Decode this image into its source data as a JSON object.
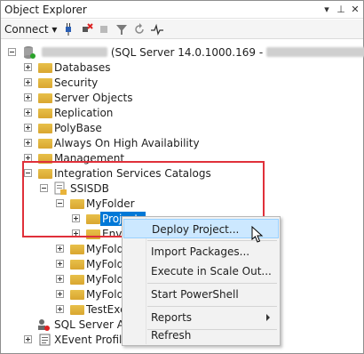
{
  "window": {
    "title": "Object Explorer"
  },
  "toolbar": {
    "connect_label": "Connect ▾"
  },
  "tree": {
    "server_label": "(SQL Server 14.0.1000.169 -",
    "server_close": ")",
    "items": {
      "databases": "Databases",
      "security": "Security",
      "server_objects": "Server Objects",
      "replication": "Replication",
      "polybase": "PolyBase",
      "always_on": "Always On High Availability",
      "management": "Management",
      "isc": "Integration Services Catalogs",
      "ssisdb": "SSISDB",
      "myfolder": "MyFolder",
      "projects": "Projects",
      "envi": "Envi",
      "myfolde_1": "MyFolde",
      "myfolde_2": "MyFolde",
      "myfolde_3": "MyFolde",
      "myfolde_4": "MyFolde",
      "testexce": "TestExce",
      "sql_agent": "SQL Server Age",
      "xevent": "XEvent Profiler"
    }
  },
  "context_menu": {
    "deploy": "Deploy Project...",
    "import": "Import Packages...",
    "execute": "Execute in Scale Out...",
    "powershell": "Start PowerShell",
    "reports": "Reports",
    "refresh": "Refresh"
  },
  "colors": {
    "selection": "#0078d7",
    "highlight_box": "#e0303a",
    "menu_hover": "#cce8ff"
  }
}
